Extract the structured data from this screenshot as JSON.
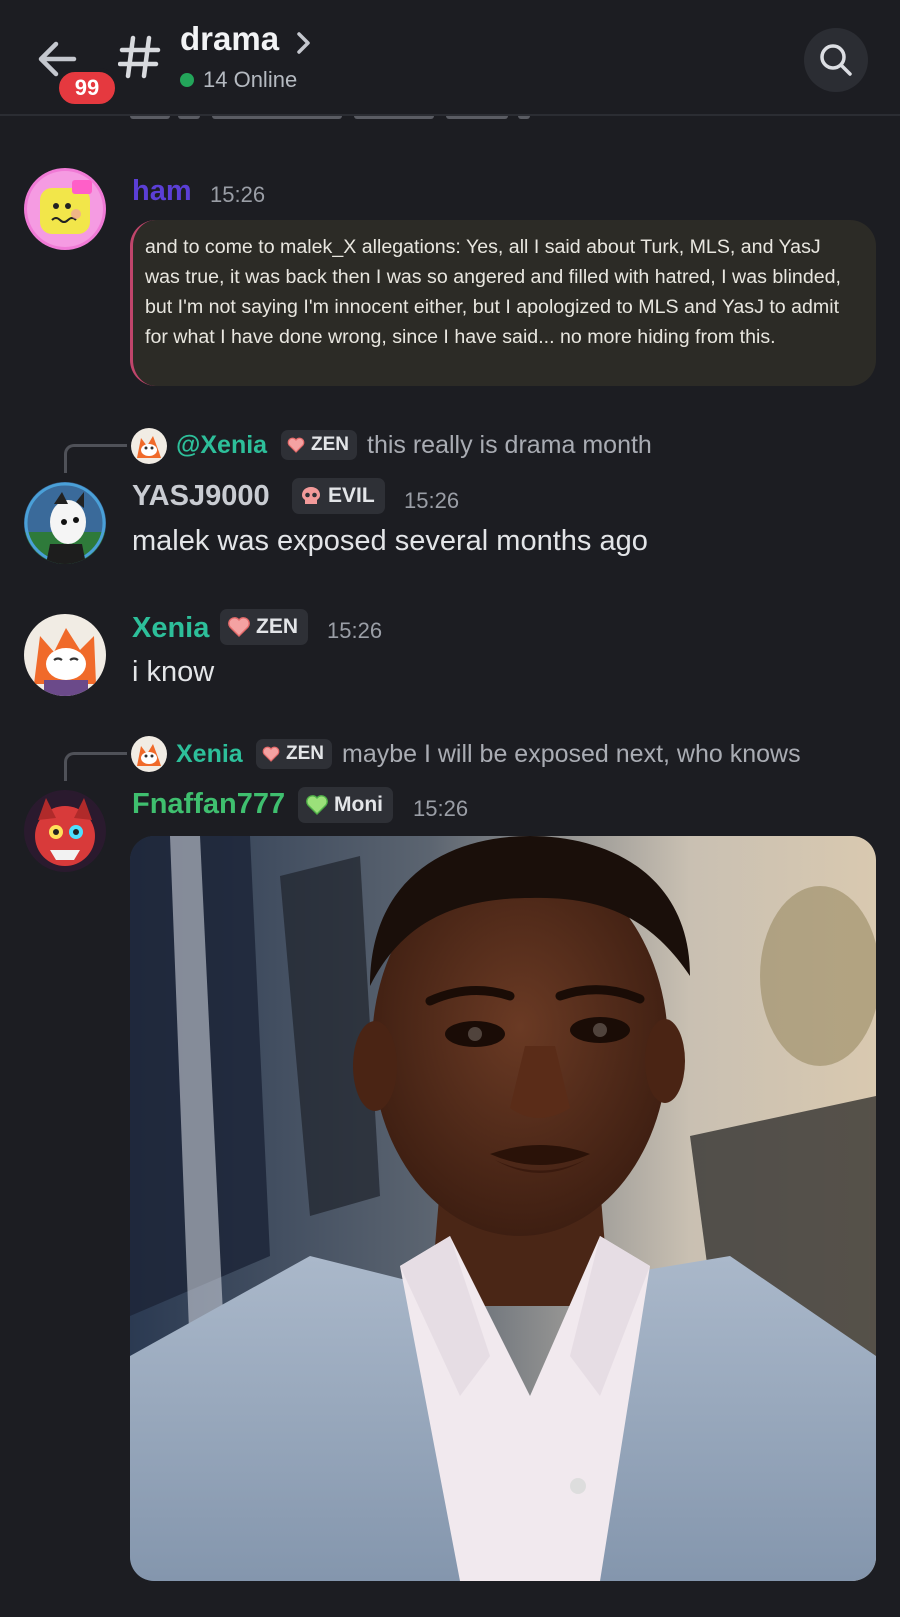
{
  "header": {
    "unread_count": "99",
    "channel_name": "drama",
    "online_status": "14 Online"
  },
  "messages": [
    {
      "username": "ham",
      "username_color": "#5b3fd6",
      "time": "15:26",
      "quote": "and to come to malek_X allegations: Yes, all I said about Turk, MLS, and YasJ was true, it was back then I was so angered and filled with hatred, I was blinded, but I'm not saying I'm innocent either, but I apologized to MLS and YasJ to admit for what I have done wrong, since I have said... no more hiding from this."
    },
    {
      "reply": {
        "name": "@Xenia",
        "tag": "ZEN",
        "text": "this really is drama month"
      },
      "username": "YASJ9000",
      "username_color": "#c9ccd2",
      "tag": "EVIL",
      "time": "15:26",
      "text": "malek was exposed several months ago"
    },
    {
      "username": "Xenia",
      "username_color": "#2dbf9a",
      "tag": "ZEN",
      "time": "15:26",
      "text": "i know"
    },
    {
      "reply": {
        "name": "Xenia",
        "tag": "ZEN",
        "text": "maybe I will be exposed next, who knows"
      },
      "username": "Fnaffan777",
      "username_color": "#3fbf6f",
      "tag": "Moni",
      "time": "15:26",
      "attachment": "photo"
    }
  ],
  "icons": {
    "back": "arrow-left-icon",
    "channel": "hash-icon",
    "chevron": "chevron-right-icon",
    "search": "search-icon",
    "zen_tag": "heart-icon",
    "evil_tag": "skull-icon",
    "moni_tag": "green-heart-icon"
  }
}
